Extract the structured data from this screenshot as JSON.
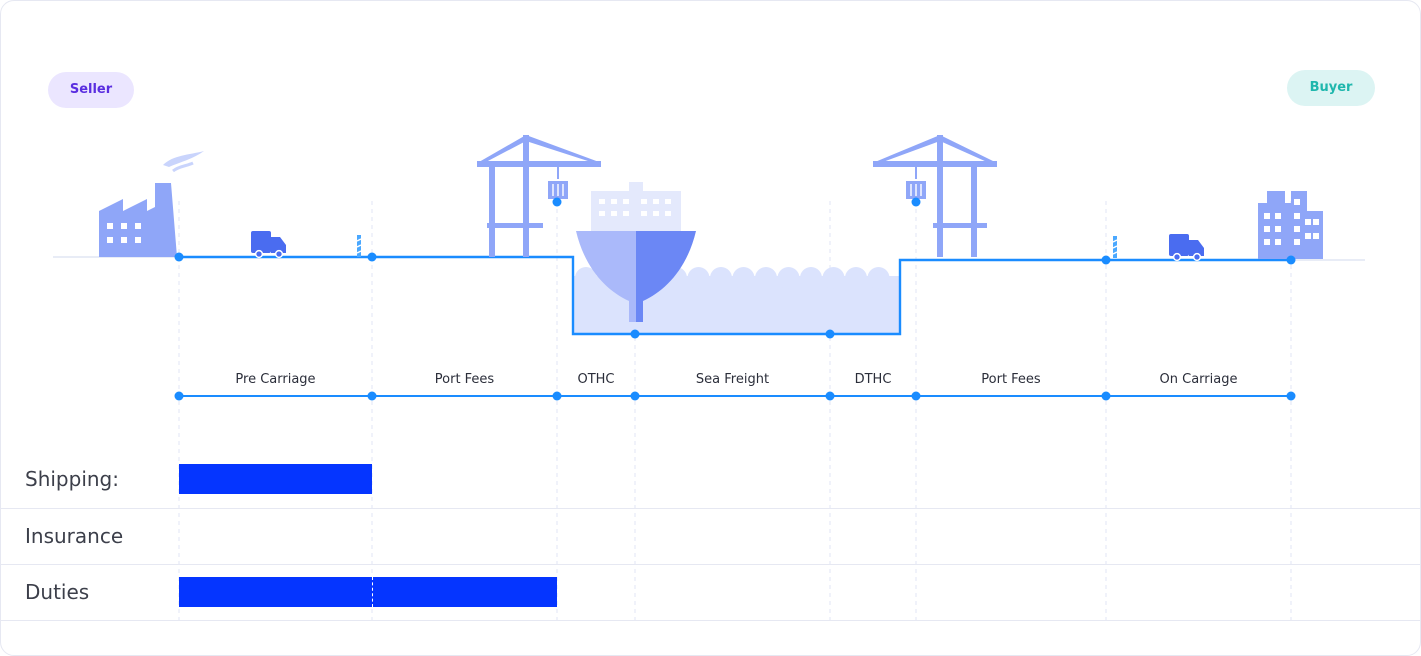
{
  "parties": {
    "seller": "Seller",
    "buyer": "Buyer"
  },
  "segments": [
    {
      "label": "Pre Carriage"
    },
    {
      "label": "Port Fees"
    },
    {
      "label": "OTHC"
    },
    {
      "label": "Sea Freight"
    },
    {
      "label": "DTHC"
    },
    {
      "label": "Port Fees"
    },
    {
      "label": "On Carriage"
    }
  ],
  "rows": [
    {
      "label": "Shipping:",
      "covered_segments": 1
    },
    {
      "label": "Insurance",
      "covered_segments": 0
    },
    {
      "label": "Duties",
      "covered_segments": 2
    }
  ],
  "colors": {
    "route": "#1a8cff",
    "illustration": "#8fa6f8",
    "illustration_dark": "#6b87f5",
    "sea": "#dbe3fd",
    "bar": "#0535ff",
    "guide": "#e2e6f4"
  },
  "icons": [
    "factory-icon",
    "truck-icon",
    "crane-icon",
    "container-icon",
    "ship-icon",
    "buoy-icon",
    "building-icon"
  ]
}
